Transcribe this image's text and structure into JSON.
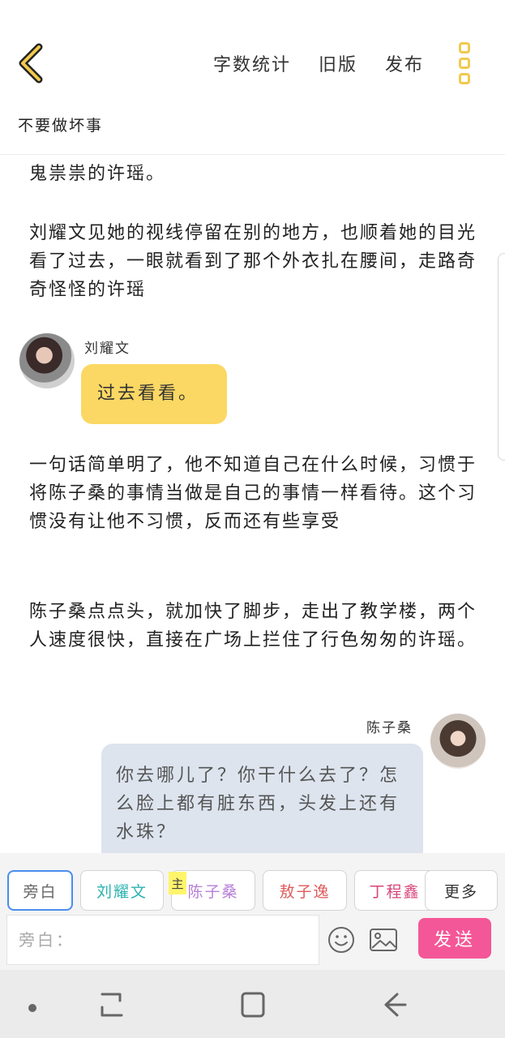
{
  "header": {
    "actions": [
      "字数统计",
      "旧版",
      "发布"
    ],
    "back_icon": "chevron-left-icon",
    "more_icon": "kebab-menu-icon",
    "accent_color": "#f2c94c"
  },
  "document": {
    "title": "不要做坏事"
  },
  "content": {
    "para1": "鬼祟祟的许瑶。",
    "para2": "刘耀文见她的视线停留在别的地方，也顺着她的目光看了过去，一眼就看到了那个外衣扎在腰间，走路奇奇怪怪的许瑶",
    "dialog1": {
      "speaker": "刘耀文",
      "text": "过去看看。",
      "bubble_color": "#fbd863"
    },
    "para3": "一句话简单明了，他不知道自己在什么时候，习惯于将陈子桑的事情当做是自己的事情一样看待。这个习惯没有让他不习惯，反而还有些享受",
    "para4": "陈子桑点点头，就加快了脚步，走出了教学楼，两个人速度很快，直接在广场上拦住了行色匆匆的许瑶。",
    "dialog2": {
      "speaker": "陈子桑",
      "text": "你去哪儿了？你干什么去了？怎么脸上都有脏东西，头发上还有水珠？",
      "bubble_color": "#dde4ee"
    }
  },
  "characters": {
    "items": [
      {
        "label": "旁白",
        "color": "#666666",
        "selected": true
      },
      {
        "label": "刘耀文",
        "color": "#2bb3b0"
      },
      {
        "label": "陈子桑",
        "color": "#b77fd6",
        "badge": "主"
      },
      {
        "label": "敖子逸",
        "color": "#e05a5a"
      },
      {
        "label": "丁程鑫",
        "color": "#d8457a"
      },
      {
        "label": "更多",
        "color": "#333333"
      }
    ]
  },
  "input": {
    "placeholder": "旁白：",
    "value": "",
    "emoji_icon": "smiley-icon",
    "image_icon": "image-icon",
    "send_label": "发送",
    "send_color": "#f45797"
  },
  "system_nav": {
    "items": [
      "dot-icon",
      "recents-icon",
      "home-icon",
      "back-arrow-icon"
    ]
  }
}
